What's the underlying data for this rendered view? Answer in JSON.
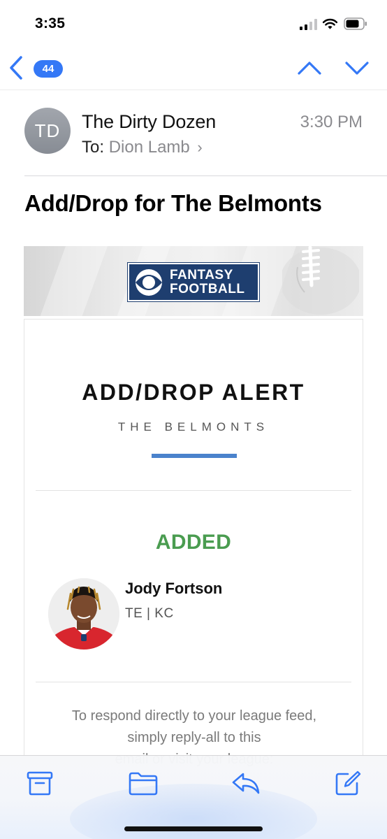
{
  "status_bar": {
    "time": "3:35"
  },
  "nav": {
    "unread_count": "44"
  },
  "header": {
    "avatar_initials": "TD",
    "sender": "The Dirty Dozen",
    "to_label": "To:",
    "to_name": "Dion Lamb",
    "time": "3:30 PM"
  },
  "subject": "Add/Drop for The Belmonts",
  "email": {
    "logo_line1": "FANTASY",
    "logo_line2": "FOOTBALL",
    "alert_title": "ADD/DROP ALERT",
    "team_name": "THE BELMONTS",
    "added_heading": "ADDED",
    "player": {
      "name": "Jody Fortson",
      "position_team": "TE | KC"
    },
    "footer_line1": "To respond directly to your league feed,",
    "footer_line2": "simply reply-all to this",
    "footer_line3": "email or visit your league:"
  },
  "colors": {
    "accent_blue": "#3478f6",
    "added_green": "#4a9c50",
    "logo_navy": "#1e3e6f",
    "bar_blue": "#4a82cc"
  },
  "icons": {
    "back": "chevron-left-icon",
    "up": "chevron-up-icon",
    "down": "chevron-down-icon",
    "archive": "archive-icon",
    "move": "folder-icon",
    "reply": "reply-icon",
    "compose": "compose-icon"
  }
}
